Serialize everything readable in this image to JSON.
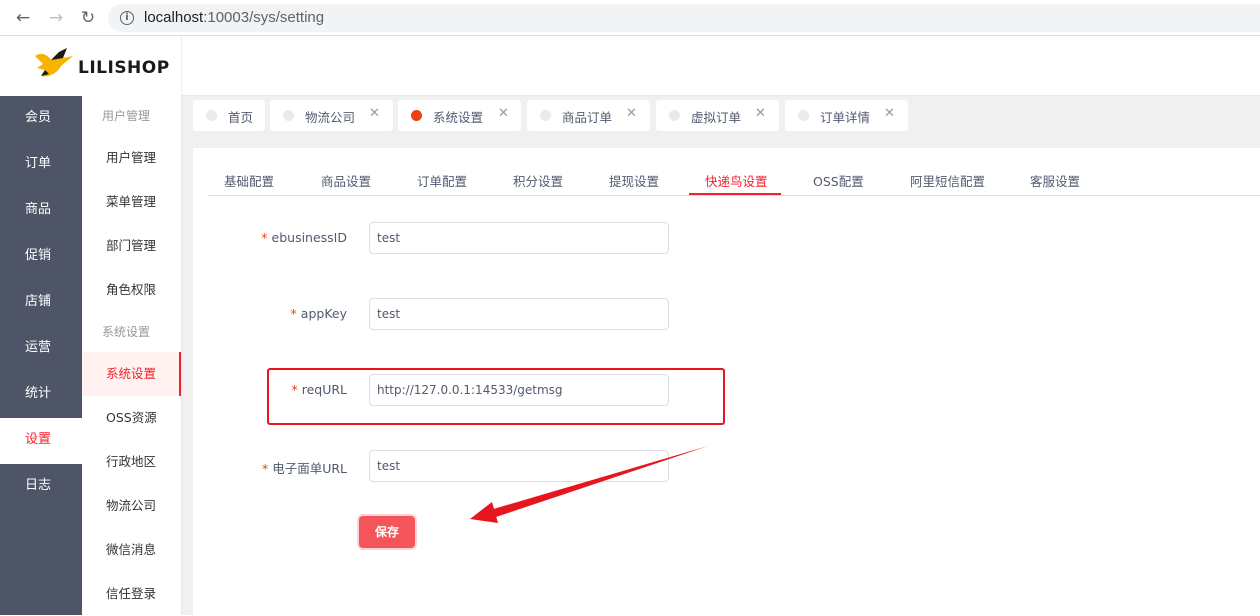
{
  "browser": {
    "url_host": "localhost",
    "url_rest": ":10003/sys/setting"
  },
  "logo": {
    "text": "LILISHOP"
  },
  "nav1": {
    "items": [
      {
        "label": "会员"
      },
      {
        "label": "订单"
      },
      {
        "label": "商品"
      },
      {
        "label": "促销"
      },
      {
        "label": "店铺"
      },
      {
        "label": "运营"
      },
      {
        "label": "统计"
      },
      {
        "label": "设置",
        "active": true
      },
      {
        "label": "日志"
      }
    ]
  },
  "nav2": {
    "group_user": "用户管理",
    "user_items": [
      "用户管理",
      "菜单管理",
      "部门管理",
      "角色权限"
    ],
    "group_system": "系统设置",
    "system_items": [
      "系统设置",
      "OSS资源",
      "行政地区",
      "物流公司",
      "微信消息",
      "信任登录"
    ]
  },
  "tabs": [
    {
      "label": "首页",
      "closable": false
    },
    {
      "label": "物流公司",
      "closable": true
    },
    {
      "label": "系统设置",
      "closable": true,
      "active": true
    },
    {
      "label": "商品订单",
      "closable": true
    },
    {
      "label": "虚拟订单",
      "closable": true
    },
    {
      "label": "订单详情",
      "closable": true
    }
  ],
  "subtabs": [
    "基础配置",
    "商品设置",
    "订单配置",
    "积分设置",
    "提现设置",
    "快递鸟设置",
    "OSS配置",
    "阿里短信配置",
    "客服设置"
  ],
  "subtab_active": "快递鸟设置",
  "form": {
    "fields": [
      {
        "label": "ebusinessID",
        "value": "test"
      },
      {
        "label": "appKey",
        "value": "test"
      },
      {
        "label": "reqURL",
        "value": "http://127.0.0.1:14533/getmsg"
      },
      {
        "label": "电子面单URL",
        "value": "test"
      }
    ],
    "required_mark": "*",
    "save_label": "保存"
  },
  "colors": {
    "accent": "#f5222d",
    "save_button": "#f4555a",
    "sidebar_bg": "#4d5566",
    "annotation": "#e8151e"
  }
}
